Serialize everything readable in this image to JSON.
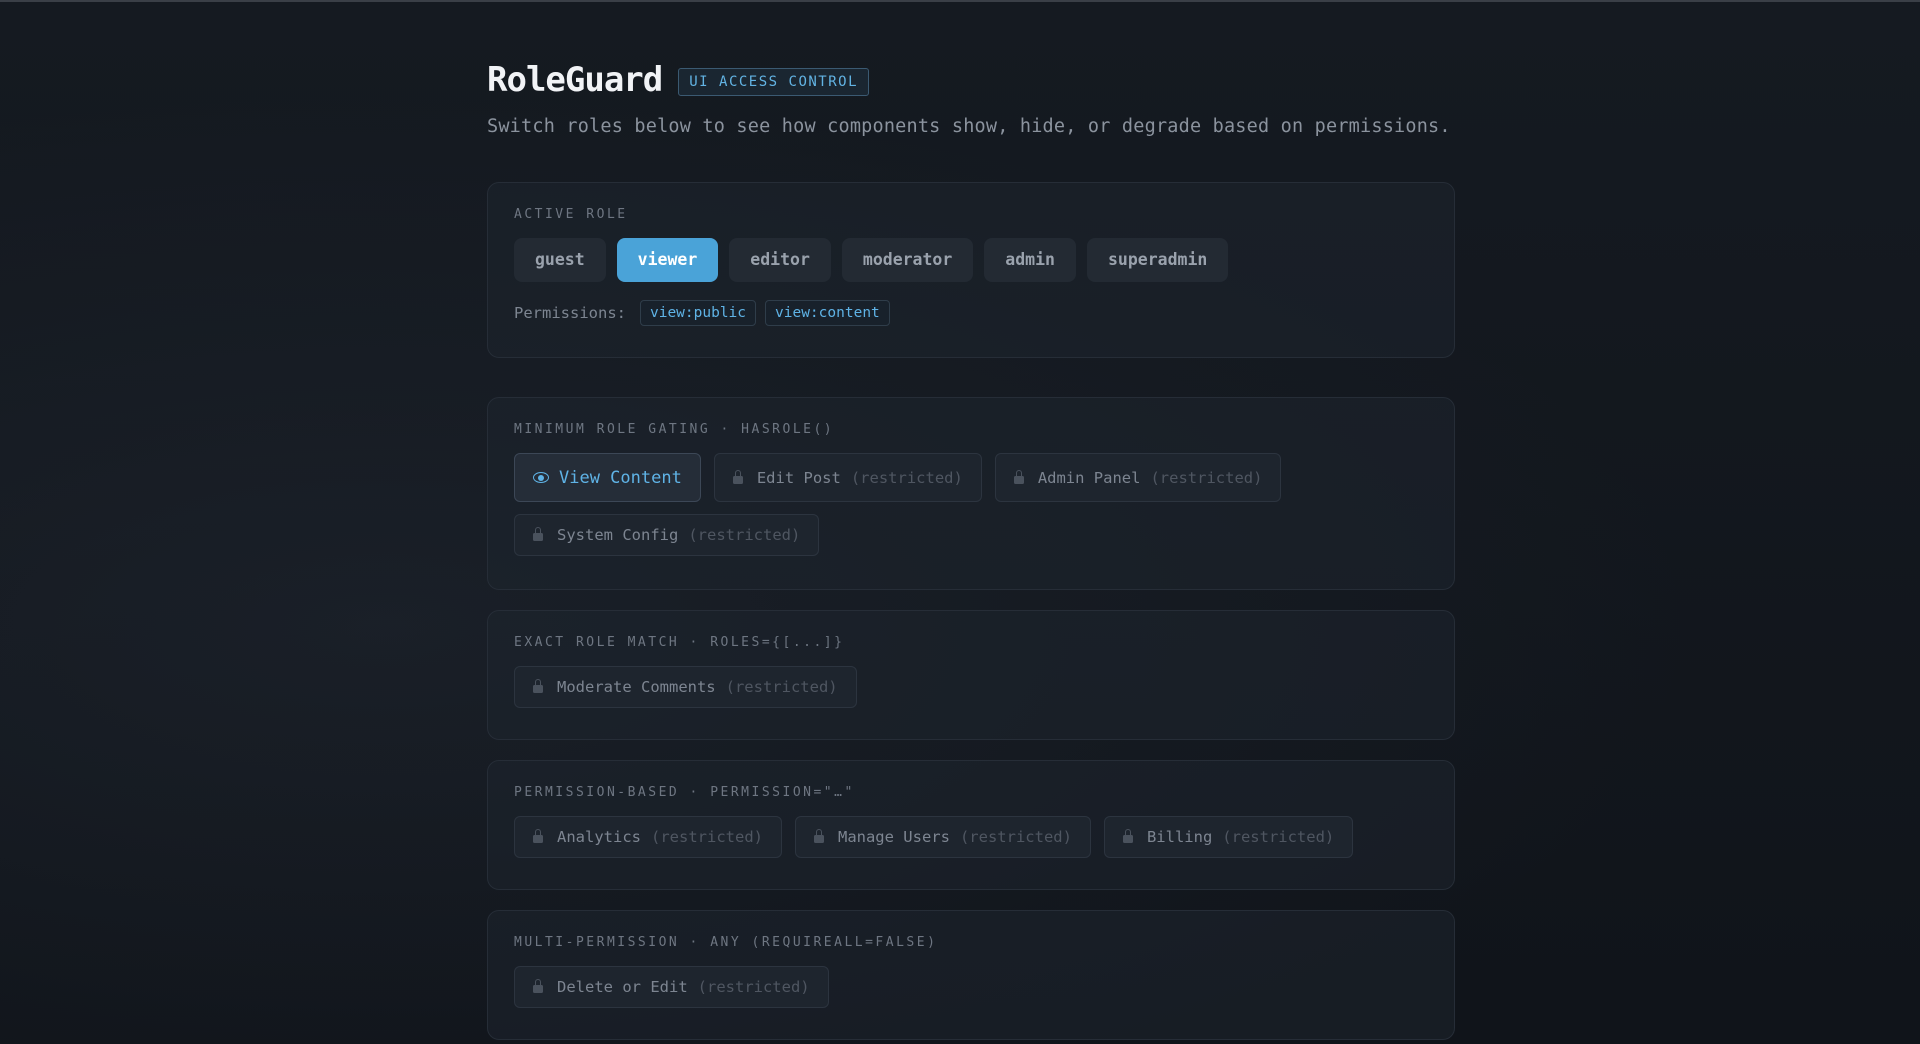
{
  "header": {
    "title": "RoleGuard",
    "tag": "UI ACCESS CONTROL",
    "subtitle": "Switch roles below to see how components show, hide, or degrade based on permissions."
  },
  "role_card": {
    "label": "ACTIVE ROLE",
    "roles": [
      "guest",
      "viewer",
      "editor",
      "moderator",
      "admin",
      "superadmin"
    ],
    "active_role": "viewer",
    "permissions_label": "Permissions:",
    "permissions": [
      "view:public",
      "view:content"
    ]
  },
  "sections": [
    {
      "label": "MINIMUM ROLE GATING · HASROLE()",
      "items": [
        {
          "name": "View Content",
          "restricted": "",
          "allowed": true,
          "icon": "eye-icon"
        },
        {
          "name": "Edit Post",
          "restricted": "(restricted)",
          "allowed": false,
          "icon": "lock-icon"
        },
        {
          "name": "Admin Panel",
          "restricted": "(restricted)",
          "allowed": false,
          "icon": "lock-icon"
        },
        {
          "name": "System Config",
          "restricted": "(restricted)",
          "allowed": false,
          "icon": "lock-icon"
        }
      ]
    },
    {
      "label": "EXACT ROLE MATCH · ROLES={[...]}",
      "items": [
        {
          "name": "Moderate Comments",
          "restricted": "(restricted)",
          "allowed": false,
          "icon": "lock-icon"
        }
      ]
    },
    {
      "label": "PERMISSION-BASED · PERMISSION=\"…\"",
      "items": [
        {
          "name": "Analytics",
          "restricted": "(restricted)",
          "allowed": false,
          "icon": "lock-icon"
        },
        {
          "name": "Manage Users",
          "restricted": "(restricted)",
          "allowed": false,
          "icon": "lock-icon"
        },
        {
          "name": "Billing",
          "restricted": "(restricted)",
          "allowed": false,
          "icon": "lock-icon"
        }
      ]
    },
    {
      "label": "MULTI-PERMISSION · ANY (REQUIREALL=FALSE)",
      "items": [
        {
          "name": "Delete or Edit",
          "restricted": "(restricted)",
          "allowed": false,
          "icon": "lock-icon"
        }
      ]
    }
  ],
  "colors": {
    "accent": "#4aa3d8",
    "background": "#12161d",
    "card": "#1e242d"
  }
}
